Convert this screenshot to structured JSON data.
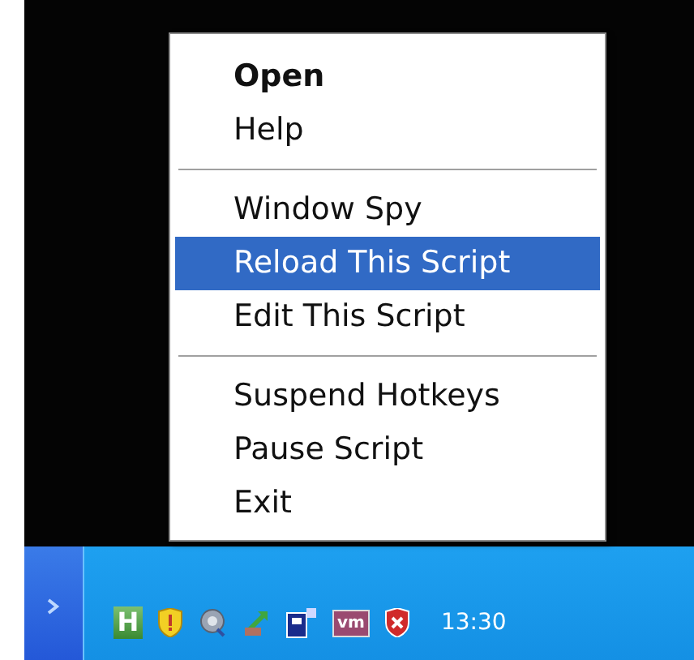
{
  "menu": {
    "items": [
      {
        "kind": "item",
        "label": "Open",
        "default": true,
        "selected": false
      },
      {
        "kind": "item",
        "label": "Help",
        "default": false,
        "selected": false
      },
      {
        "kind": "separator"
      },
      {
        "kind": "item",
        "label": "Window Spy",
        "default": false,
        "selected": false
      },
      {
        "kind": "item",
        "label": "Reload This Script",
        "default": false,
        "selected": true
      },
      {
        "kind": "item",
        "label": "Edit This Script",
        "default": false,
        "selected": false
      },
      {
        "kind": "separator"
      },
      {
        "kind": "item",
        "label": "Suspend Hotkeys",
        "default": false,
        "selected": false
      },
      {
        "kind": "item",
        "label": "Pause Script",
        "default": false,
        "selected": false
      },
      {
        "kind": "item",
        "label": "Exit",
        "default": false,
        "selected": false
      }
    ]
  },
  "taskbar": {
    "tray_icons": [
      {
        "kind": "letter",
        "label": "H"
      },
      {
        "kind": "warning-shield"
      },
      {
        "kind": "swirl"
      },
      {
        "kind": "arrow"
      },
      {
        "kind": "square"
      },
      {
        "kind": "badge",
        "label": "vm"
      },
      {
        "kind": "cross-shield"
      }
    ],
    "clock": "13:30"
  }
}
